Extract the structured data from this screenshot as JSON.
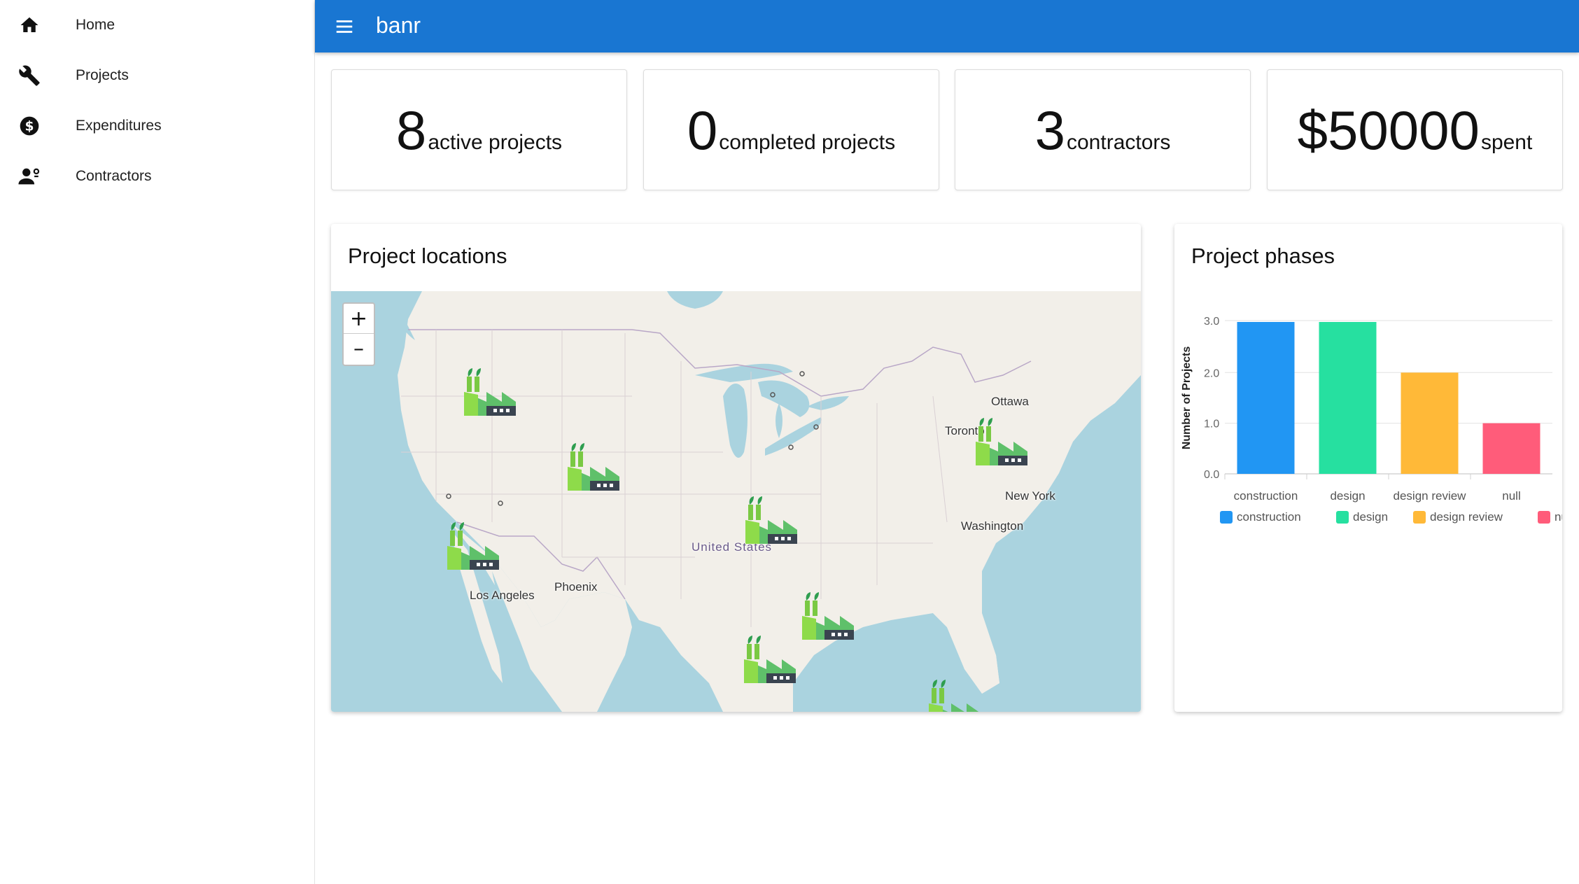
{
  "sidebar": {
    "items": [
      {
        "label": "Home",
        "icon": "home-icon"
      },
      {
        "label": "Projects",
        "icon": "wrench-icon"
      },
      {
        "label": "Expenditures",
        "icon": "dollar-icon"
      },
      {
        "label": "Contractors",
        "icon": "contractor-icon"
      }
    ]
  },
  "topbar": {
    "title": "banr",
    "accent": "#1976d2"
  },
  "stats": [
    {
      "value": "8",
      "label": "active projects"
    },
    {
      "value": "0",
      "label": "completed projects"
    },
    {
      "value": "3",
      "label": "contractors"
    },
    {
      "value": "$50000",
      "label": "spent"
    }
  ],
  "map_panel": {
    "title": "Project locations",
    "zoom_in": "+",
    "zoom_out": "–",
    "labels": [
      "Ottawa",
      "Toronto",
      "New York",
      "Washington",
      "United States",
      "Phoenix",
      "Los Angeles"
    ]
  },
  "chart_panel": {
    "title": "Project phases"
  },
  "chart_data": {
    "type": "bar",
    "categories": [
      "construction",
      "design",
      "design review",
      "null"
    ],
    "values": [
      3,
      3,
      2,
      1
    ],
    "colors": [
      "#2196f3",
      "#26e0a0",
      "#ffb938",
      "#ff5c7a"
    ],
    "ylabel": "Number of Projects",
    "xlabel": "",
    "ylim": [
      0,
      3
    ],
    "yticks": [
      "0.0",
      "1.0",
      "2.0",
      "3.0"
    ],
    "legend": [
      "construction",
      "design",
      "design review",
      "null"
    ],
    "legend_position": "bottom",
    "grid": true
  }
}
